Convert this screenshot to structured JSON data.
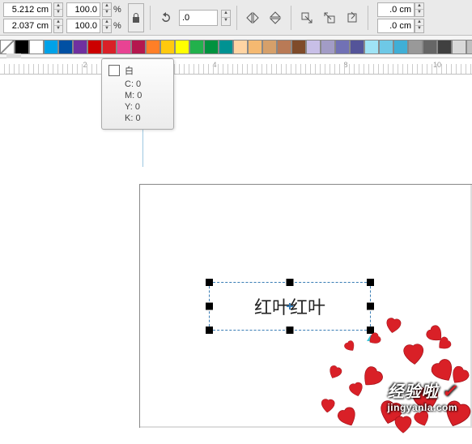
{
  "toolbar": {
    "width": "5.212 cm",
    "height": "2.037 cm",
    "scaleX": "100.0",
    "scaleY": "100.0",
    "pctLabel": "%",
    "rotation": ".0",
    "outlineX": ".0 cm",
    "outlineY": ".0 cm"
  },
  "palette": {
    "colors": [
      "none",
      "#000000",
      "#ffffff",
      "#00a2e8",
      "#0150a3",
      "#7030a0",
      "#cc0000",
      "#d92027",
      "#e84393",
      "#b5174e",
      "#ff7f27",
      "#ffc90e",
      "#ffff00",
      "#22b14c",
      "#00923f",
      "#009292",
      "#ffd4a3",
      "#f5b971",
      "#d6a06a",
      "#b97a56",
      "#7f4b2a",
      "#c8bfe7",
      "#a29cc6",
      "#7171b5",
      "#545499",
      "#9fe3f5",
      "#6ec8e6",
      "#40afd6",
      "#999999",
      "#666666",
      "#404040",
      "#d9d9d9",
      "#bfbfbf",
      "#808080"
    ],
    "tooltip": {
      "name": "白",
      "c": "C: 0",
      "m": "M: 0",
      "y": "Y: 0",
      "k": "K: 0"
    }
  },
  "ruler": {
    "ticks": [
      {
        "pos": 105,
        "label": "2"
      },
      {
        "pos": 265,
        "label": "4"
      },
      {
        "pos": 427,
        "label": "8"
      },
      {
        "pos": 540,
        "label": "10"
      }
    ]
  },
  "canvas": {
    "textObject": "红叶红叶"
  },
  "watermark": {
    "line1": "经验啦",
    "line2": "jingyanla.com"
  }
}
